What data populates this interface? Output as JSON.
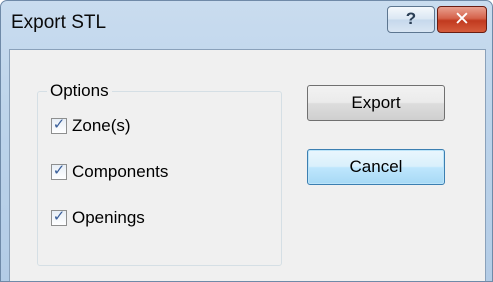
{
  "window": {
    "title": "Export STL",
    "help_glyph": "?",
    "close_glyph": "✕"
  },
  "options": {
    "legend": "Options",
    "items": [
      {
        "label": "Zone(s)",
        "checked": true
      },
      {
        "label": "Components",
        "checked": true
      },
      {
        "label": "Openings",
        "checked": true
      }
    ]
  },
  "buttons": {
    "export_label": "Export",
    "cancel_label": "Cancel"
  },
  "colors": {
    "titlebar": "#bcd3ea",
    "close_button": "#c13a1f",
    "default_button": "#bee6fd",
    "dialog_face": "#f0f0f0"
  },
  "icons": {
    "check": "✓"
  }
}
